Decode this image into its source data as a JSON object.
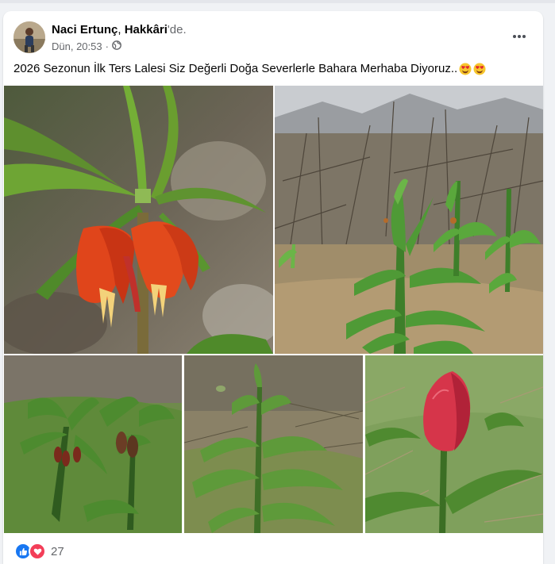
{
  "post": {
    "author_name": "Naci Ertunç",
    "location_separator": ", ",
    "location": "Hakkâri",
    "location_suffix": "'de.",
    "timestamp": "Dün, 20:53",
    "meta_dot": "·",
    "privacy_icon": "globe-icon",
    "caption": "2026 Sezonun İlk Ters Lalesi Siz Değerli Doğa Severlerle Bahara Merhaba Diyoruz..",
    "caption_emojis": [
      "heart-eyes-emoji",
      "heart-eyes-emoji"
    ]
  },
  "photos": [
    {
      "name": "photo-crown-imperial-closeup",
      "subject": "orange crown imperial flower"
    },
    {
      "name": "photo-crown-imperial-field",
      "subject": "crown imperial plants in mountain field"
    },
    {
      "name": "photo-crown-imperial-buds",
      "subject": "crown imperial with red buds"
    },
    {
      "name": "photo-crown-imperial-young",
      "subject": "young crown imperial plant"
    },
    {
      "name": "photo-red-tulip",
      "subject": "red tulip bud"
    }
  ],
  "reactions": {
    "icons": [
      "like-icon",
      "love-icon"
    ],
    "count": "27"
  },
  "colors": {
    "like_blue": "#1877f2",
    "love_red": "#f33e58",
    "text_primary": "#050505",
    "text_secondary": "#65676b"
  }
}
